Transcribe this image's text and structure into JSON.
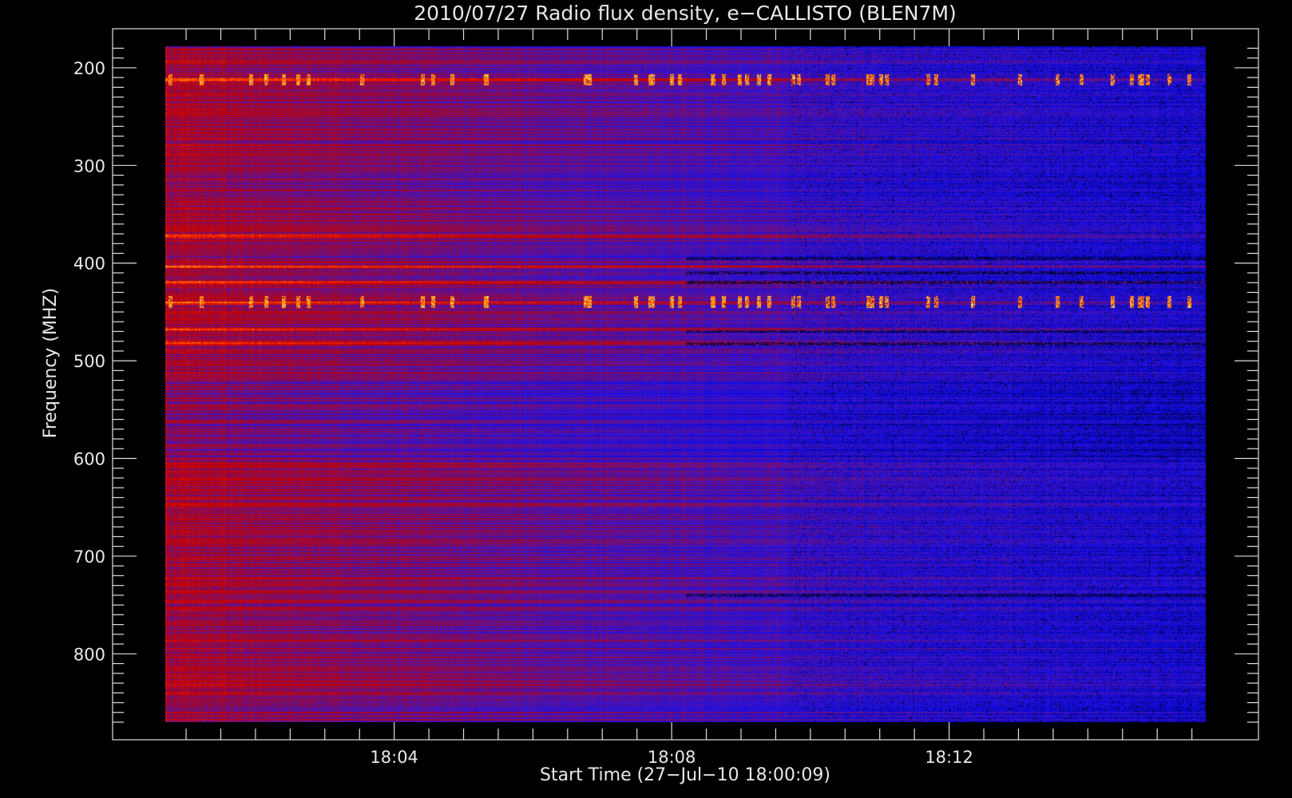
{
  "chart_data": {
    "type": "heatmap",
    "title": "2010/07/27  Radio flux density, e−CALLISTO (BLEN7M)",
    "xlabel": "Start Time (27−Jul−10 18:00:09)",
    "ylabel": "Frequency (MHZ)",
    "x_range_minutes": [
      0.7,
      15.7
    ],
    "y_range_mhz": [
      178,
      870
    ],
    "y_inverted": true,
    "x_ticks": [
      {
        "minute": 4,
        "label": "18:04"
      },
      {
        "minute": 8,
        "label": "18:08"
      },
      {
        "minute": 12,
        "label": "18:12"
      }
    ],
    "y_ticks": [
      {
        "mhz": 200,
        "label": "200"
      },
      {
        "mhz": 300,
        "label": "300"
      },
      {
        "mhz": 400,
        "label": "400"
      },
      {
        "mhz": 500,
        "label": "500"
      },
      {
        "mhz": 600,
        "label": "600"
      },
      {
        "mhz": 700,
        "label": "700"
      },
      {
        "mhz": 800,
        "label": "800"
      }
    ],
    "colormap": [
      "#000000",
      "#0000ff",
      "#b00000",
      "#ff2000",
      "#ff9000",
      "#ffff80"
    ],
    "background": "#000000",
    "text_color": "#e8e8e8",
    "features": {
      "bright_bands_mhz": [
        212,
        372,
        404,
        420,
        440,
        468,
        482
      ],
      "dark_bands_mhz": [
        395,
        410,
        420,
        470,
        483,
        740
      ],
      "bursty_bands_mhz": [
        212,
        440
      ]
    }
  }
}
